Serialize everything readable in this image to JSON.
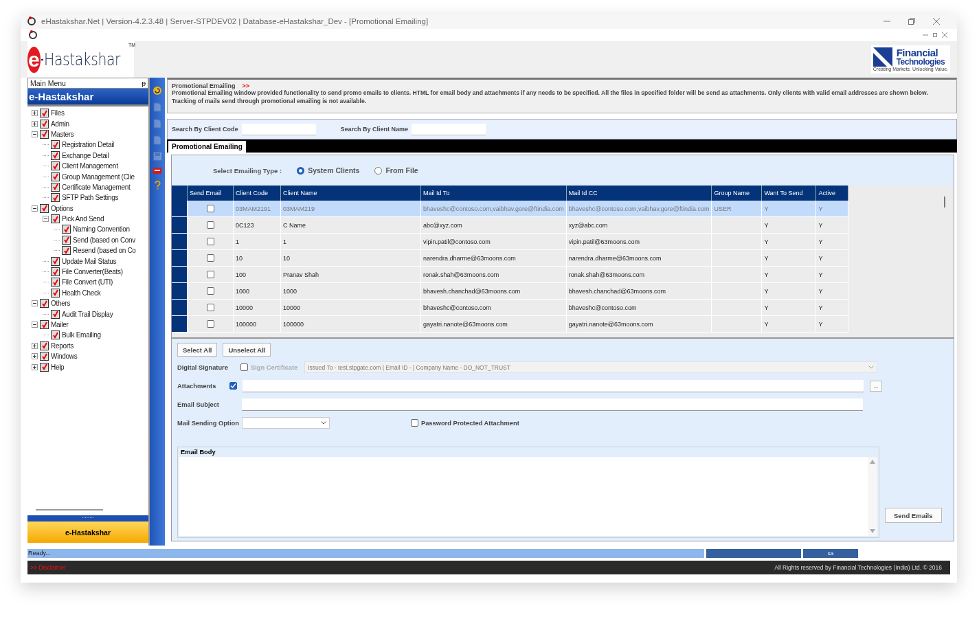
{
  "window": {
    "title": "eHastakshar.Net | Version-4.2.3.48 | Server-STPDEV02 | Database-eHastakshar_Dev - [Promotional Emailing]"
  },
  "logo": {
    "text": "Hastakshar",
    "letter": "e",
    "mark": "TM"
  },
  "partner_logo": {
    "line1": "Financial",
    "line2": "Technologies",
    "tagline": "Creating Markets. Unlocking Value."
  },
  "sidebar": {
    "title": "Main Menu",
    "pin": "ᵽ",
    "header": "e-Hastakshar",
    "footer_button": "e-Hastakshar",
    "grip": "........",
    "items": [
      {
        "label": "Files",
        "checked": true,
        "expanded": false
      },
      {
        "label": "Admin",
        "checked": true,
        "expanded": false
      },
      {
        "label": "Masters",
        "checked": true,
        "expanded": true,
        "children": [
          {
            "label": "Registration Detail",
            "checked": true
          },
          {
            "label": "Exchange Detail",
            "checked": true
          },
          {
            "label": "Client Management",
            "checked": true
          },
          {
            "label": "Group Management (Clie",
            "checked": true
          },
          {
            "label": "Certificate Management",
            "checked": true
          },
          {
            "label": "SFTP Path Settings",
            "checked": true
          }
        ]
      },
      {
        "label": "Options",
        "checked": true,
        "expanded": true,
        "children": [
          {
            "label": "Pick And Send",
            "checked": true,
            "expanded": true,
            "children": [
              {
                "label": "Naming Convention",
                "checked": true
              },
              {
                "label": "Send (based on Conv",
                "checked": true
              },
              {
                "label": "Resend (based on Co",
                "checked": true
              }
            ]
          },
          {
            "label": "Update Mail Status",
            "checked": true
          },
          {
            "label": "File Converter(Beats)",
            "checked": true
          },
          {
            "label": "File Convert (UTI)",
            "checked": true
          },
          {
            "label": "Health Check",
            "checked": true
          }
        ]
      },
      {
        "label": "Others",
        "checked": true,
        "expanded": true,
        "children": [
          {
            "label": "Audit Trail Display",
            "checked": true
          }
        ]
      },
      {
        "label": "Mailer",
        "checked": true,
        "expanded": true,
        "children": [
          {
            "label": "Bulk Emailing",
            "checked": true
          }
        ]
      },
      {
        "label": "Reports",
        "checked": true,
        "expanded": false
      },
      {
        "label": "Windows",
        "checked": true,
        "expanded": false
      },
      {
        "label": "Help",
        "checked": true,
        "expanded": false
      }
    ]
  },
  "toolstrip": [
    {
      "kind": "refresh",
      "disabled": false
    },
    {
      "kind": "doc",
      "disabled": true
    },
    {
      "kind": "doc",
      "disabled": true
    },
    {
      "kind": "doc",
      "disabled": true
    },
    {
      "kind": "save",
      "disabled": true
    },
    {
      "kind": "exit",
      "disabled": false
    },
    {
      "kind": "help",
      "disabled": false
    }
  ],
  "info": {
    "title": "Promotional Emailing",
    "arrows": ">>",
    "description": "Promotional Emailing window provided functionality to send promo emails to clients. HTML for email body and attachments if any needs to be specified. All the files in specified folder will be send as attachments. Only clients with valid email addresses are shown below. Tracking of mails send through promotional emailing is not available."
  },
  "search": [
    {
      "label": "Search By Client Code"
    },
    {
      "label": "Search By Client Name"
    }
  ],
  "tabs": [
    {
      "label": "Promotional Emailing",
      "selected": true
    }
  ],
  "emailing_type": {
    "label": "Select Emailing Type :",
    "options": [
      {
        "label": "System Clients",
        "selected": true
      },
      {
        "label": "From File",
        "selected": false
      }
    ]
  },
  "table": {
    "columns": [
      "Send Email",
      "Client Code",
      "Client Name",
      "Mail Id To",
      "Mail Id CC",
      "Group Name",
      "Want To Send",
      "Active"
    ],
    "rows": [
      {
        "selected": true,
        "send": false,
        "cells": [
          "",
          "03MAM2191",
          "03MAM219",
          "bhaveshc@contoso.com,vaibhav.gore@ftindia.com",
          "bhaveshc@contoso.com,vaibhav.gore@ftindia.com",
          "USER",
          "Y",
          "Y"
        ]
      },
      {
        "selected": false,
        "send": false,
        "cells": [
          "",
          "0C123",
          "C Name",
          "abc@xyz.com",
          "xyz@abc.com",
          "",
          "Y",
          "Y"
        ]
      },
      {
        "selected": false,
        "send": false,
        "cells": [
          "",
          "1",
          "1",
          "vipin.patil@contoso.com",
          "vipin.patil@63moons.com",
          "",
          "Y",
          "Y"
        ]
      },
      {
        "selected": false,
        "send": false,
        "cells": [
          "",
          "10",
          "10",
          "narendra.dharme@63moons.com",
          "narendra.dharme@63moons.com",
          "",
          "Y",
          "Y"
        ]
      },
      {
        "selected": false,
        "send": false,
        "cells": [
          "",
          "100",
          "Pranav Shah",
          "ronak.shah@63moons.com",
          "ronak.shah@63moons.com",
          "",
          "Y",
          "Y"
        ]
      },
      {
        "selected": false,
        "send": false,
        "cells": [
          "",
          "1000",
          "1000",
          "bhavesh.chanchad@63moons.com",
          "bhavesh.chanchad@63moons.com",
          "",
          "Y",
          "Y"
        ]
      },
      {
        "selected": false,
        "send": false,
        "cells": [
          "",
          "10000",
          "10000",
          "bhaveshc@contoso.com",
          "bhaveshc@contoso.com",
          "",
          "Y",
          "Y"
        ]
      },
      {
        "selected": false,
        "send": false,
        "cells": [
          "",
          "100000",
          "100000",
          "gayatri.nanote@63moons.com",
          "gayatri.nanote@63moons.com",
          "",
          "Y",
          "Y"
        ]
      }
    ]
  },
  "buttons": {
    "select_all": "Select All",
    "unselect_all": "Unselect All",
    "browse": "...",
    "send": "Send Emails"
  },
  "form": {
    "digital_signature": {
      "label": "Digital Signature",
      "checked": false,
      "option_label": "Sign Certificate",
      "disabled": true,
      "certificate": "Issued To - test.stpgate.com | Email ID -  | Company Name - DO_NOT_TRUST"
    },
    "attachments": {
      "label": "Attachments",
      "checked": true
    },
    "subject": {
      "label": "Email Subject"
    },
    "sending_option": {
      "label": "Mail Sending Option"
    },
    "password_protected": {
      "label": "Password Protected Attachment",
      "checked": false
    },
    "body": {
      "label": "Email Body"
    }
  },
  "status_bar": {
    "text": "Ready...",
    "user": "sa"
  },
  "footer": {
    "disclaimer": ">> Disclaimer",
    "copyright": "All Rights reserved by Financial Technologies (India) Ltd. © 2016"
  }
}
